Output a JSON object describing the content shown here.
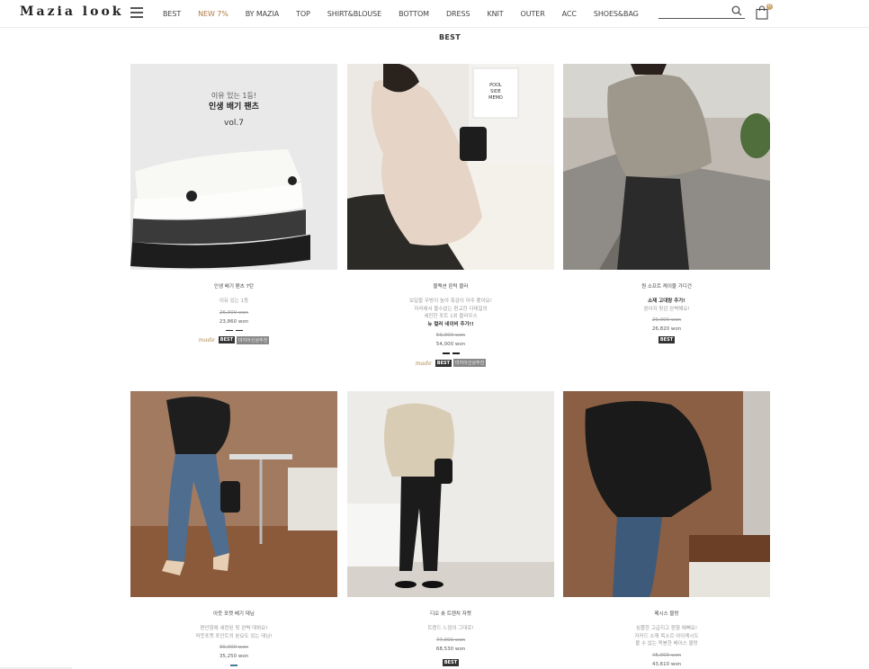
{
  "brand": {
    "logo_text": "Mazia look"
  },
  "nav": {
    "items": [
      {
        "label": "BEST",
        "accent": false
      },
      {
        "label": "NEW 7%",
        "accent": true
      },
      {
        "label": "BY MAZIA",
        "accent": false
      },
      {
        "label": "TOP",
        "accent": false
      },
      {
        "label": "SHIRT&BLOUSE",
        "accent": false
      },
      {
        "label": "BOTTOM",
        "accent": false
      },
      {
        "label": "DRESS",
        "accent": false
      },
      {
        "label": "KNIT",
        "accent": false
      },
      {
        "label": "OUTER",
        "accent": false
      },
      {
        "label": "ACC",
        "accent": false
      },
      {
        "label": "SHOES&BAG",
        "accent": false
      }
    ],
    "search_value": "",
    "cart_count": "0"
  },
  "page": {
    "title": "BEST"
  },
  "products": [
    {
      "name": "인생 배기 팬츠 7탄",
      "desc": "이유 있는 1등",
      "price_old": "26,000 won",
      "price": "23,860 won",
      "badges": {
        "made": "made",
        "best": "BEST",
        "tag": "마지아신상추천"
      },
      "overlay": {
        "line1": "이유 있는 1등!",
        "line2": "인생 배기 팬츠",
        "line3": "vol.7"
      }
    },
    {
      "name": "블랙션 핀턱 블라",
      "desc": "보일할 우방이 높아 촉감이 아주 좋아요!\n자리에서 불수없는 편교한 디테일의\n세진한 포트 1위 블라우스",
      "desc_bold": "뉴 컬러 네이비 추가!!",
      "price_old": "59,000 won",
      "price": "54,000 won",
      "badges": {
        "made": "made",
        "best": "BEST",
        "tag": "마지아신상추천"
      }
    },
    {
      "name": "원 소프트 케이블 가디건",
      "desc_bold": "소재 고대랑 추가!",
      "desc": "꼼아지 핏감 완벽해요!",
      "price_old": "29,000 won",
      "price": "26,820 won",
      "badges": {
        "best": "BEST"
      }
    },
    {
      "name": "아웃 포켓 배기 데님",
      "desc": "편안함에 세련된 핏 완벽 데뷔요!\n마웃포켓 포인트의 분요도 있는 데님!",
      "price_old": "39,000 won",
      "price": "35,250 won"
    },
    {
      "name": "디오 숏 트렌치 자켓",
      "desc": "트렌드 느낌의 그대로!",
      "price_old": "77,000 won",
      "price": "68,530 won",
      "badges": {
        "best": "BEST"
      }
    },
    {
      "name": "메시스 블랑",
      "desc": "심플한 고급지고 원형 예뻐요!\n자커드 소재 목소르 아이케시도\n볼 수 없는 독봉한 베이스 블랑",
      "price_old": "45,000 won",
      "price": "43,610 won"
    }
  ],
  "colors": {
    "accent": "#b07b45",
    "badge_best": "#333333",
    "badge_tag": "#888888"
  }
}
